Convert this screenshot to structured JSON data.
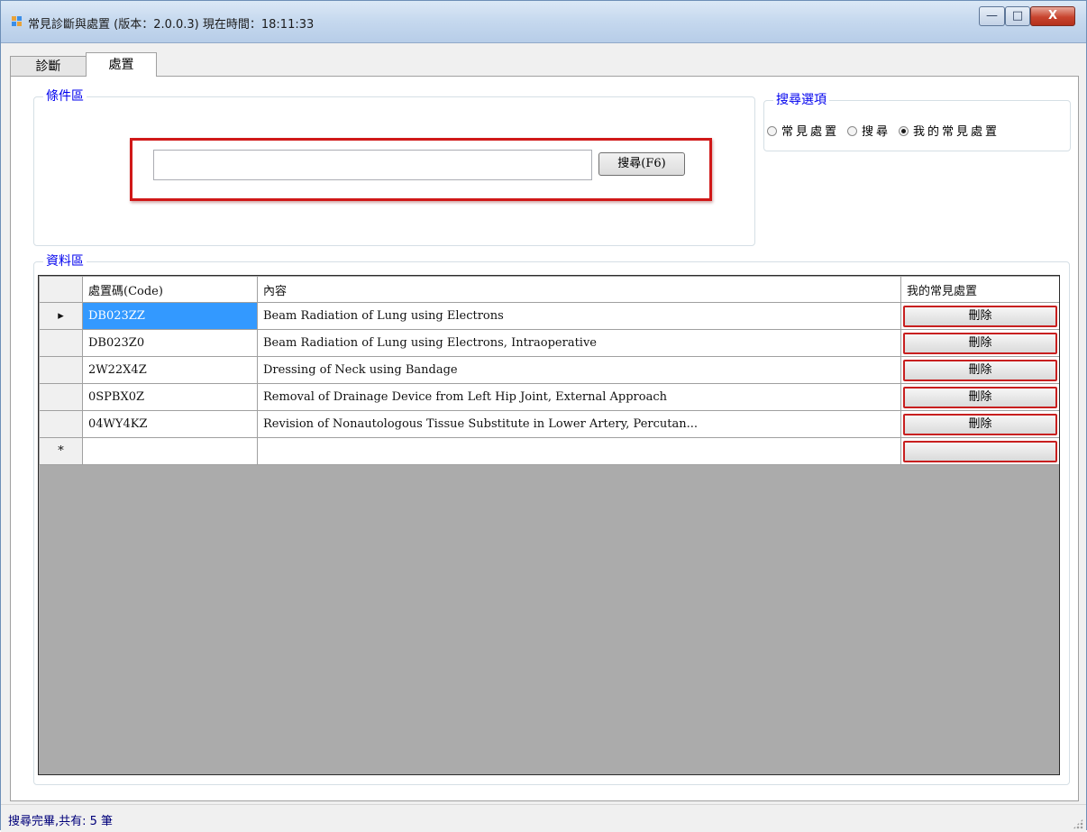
{
  "window": {
    "title": "常見診斷與處置 (版本：2.0.0.3)  現在時間：18:11:33",
    "controls": {
      "minimize": "—",
      "maximize": "□",
      "close": "X"
    }
  },
  "tabs": [
    {
      "label": "診斷",
      "active": false
    },
    {
      "label": "處置",
      "active": true
    }
  ],
  "condition_area": {
    "legend": "條件區",
    "search_value": "",
    "search_button": "搜尋(F6)"
  },
  "search_options": {
    "legend": "搜尋選項",
    "options": [
      {
        "label": "常見處置",
        "checked": false
      },
      {
        "label": "搜尋",
        "checked": false
      },
      {
        "label": "我的常見處置",
        "checked": true
      }
    ]
  },
  "data_area": {
    "legend": "資料區",
    "columns": [
      "處置碼(Code)",
      "內容",
      "我的常見處置"
    ],
    "rows": [
      {
        "indicator": "▸",
        "code": "DB023ZZ",
        "content": "Beam Radiation of Lung using Electrons",
        "action": "刪除"
      },
      {
        "indicator": "",
        "code": "DB023Z0",
        "content": "Beam Radiation of Lung using Electrons, Intraoperative",
        "action": "刪除"
      },
      {
        "indicator": "",
        "code": "2W22X4Z",
        "content": "Dressing of Neck using Bandage",
        "action": "刪除"
      },
      {
        "indicator": "",
        "code": "0SPBX0Z",
        "content": "Removal of Drainage Device from Left Hip Joint, External Approach",
        "action": "刪除"
      },
      {
        "indicator": "",
        "code": "04WY4KZ",
        "content": "Revision of Nonautologous Tissue Substitute in Lower Artery, Percutan...",
        "action": "刪除"
      }
    ],
    "new_row_indicator": "*"
  },
  "status": {
    "text": "搜尋完畢,共有: 5 筆"
  },
  "colors": {
    "legend": "#0000ee",
    "selection": "#3399ff",
    "highlight": "#d01818",
    "grid_empty": "#ababab"
  }
}
